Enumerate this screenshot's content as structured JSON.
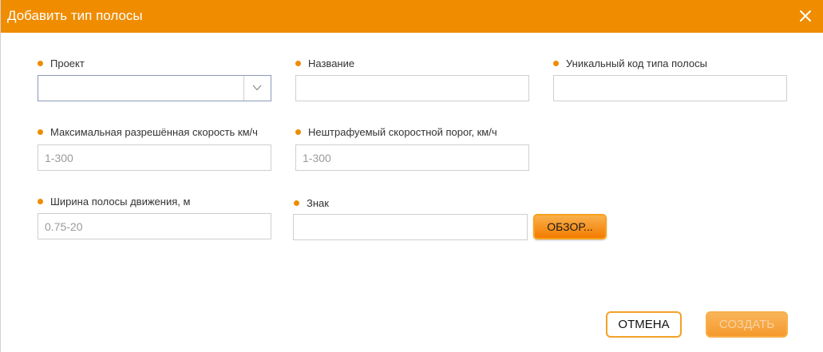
{
  "dialog": {
    "title": "Добавить тип полосы",
    "close_icon": "close-icon"
  },
  "form": {
    "project": {
      "label": "Проект",
      "value": ""
    },
    "name": {
      "label": "Название",
      "value": "",
      "placeholder": ""
    },
    "code": {
      "label": "Уникальный код типа полосы",
      "value": "",
      "placeholder": ""
    },
    "max_speed": {
      "label": "Максимальная разрешённая скорость км/ч",
      "placeholder": "1-300"
    },
    "threshold": {
      "label": "Нештрафуемый скоростной порог, км/ч",
      "placeholder": "1-300"
    },
    "width": {
      "label": "Ширина полосы движения, м",
      "placeholder": "0.75-20"
    },
    "sign": {
      "label": "Знак",
      "value": "",
      "browse_label": "ОБЗОР..."
    }
  },
  "footer": {
    "cancel_label": "ОТМЕНА",
    "create_label": "СОЗДАТЬ"
  },
  "colors": {
    "accent": "#ef8c00",
    "required_dot": "#ef8c00"
  }
}
